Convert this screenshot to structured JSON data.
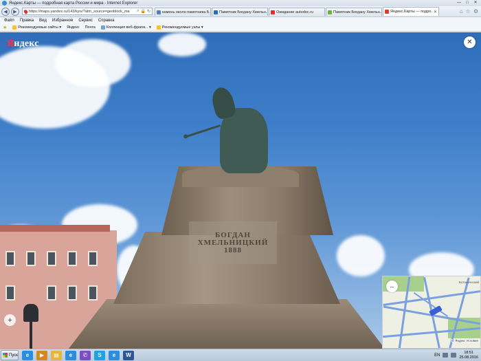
{
  "window": {
    "title": "Яндекс.Карты — подробная карта России и мира - Internet Explorer",
    "controls": [
      "—",
      "□",
      "✕"
    ]
  },
  "address_bar": {
    "url": "https://maps.yandex.ru/143/kyiv/?atm_source=geoblock_ma"
  },
  "tabs": [
    {
      "label": "камень около памятника Б...",
      "icon_color": "#5a7fbf",
      "active": false
    },
    {
      "label": "Памятник Богдану Хмельн...",
      "icon_color": "#2d6db4",
      "active": false
    },
    {
      "label": "Ожидание autodoc.ru",
      "icon_color": "#d9322f",
      "active": false
    },
    {
      "label": "Памятник Богдану Хмельн...",
      "icon_color": "#6cb33e",
      "active": false
    },
    {
      "label": "Яндекс.Карты — подро...",
      "icon_color": "#e23b2e",
      "active": true
    }
  ],
  "menu": [
    "Файл",
    "Правка",
    "Вид",
    "Избранное",
    "Сервис",
    "Справка"
  ],
  "favorites": [
    {
      "label": "Рекомендуемые сайты ▾",
      "icon_color": "#f2c230"
    },
    {
      "label": "Яндекс",
      "icon_color": ""
    },
    {
      "label": "Почта",
      "icon_color": ""
    },
    {
      "label": "Коллекция веб-фрагм... ▾",
      "icon_color": "#7aa1d1"
    },
    {
      "label": "Рекомендуемые узлы ▾",
      "icon_color": "#f2c230"
    }
  ],
  "panorama": {
    "logo_red": "Я",
    "logo_rest": "ндекс",
    "close_icon": "✕",
    "plaque_lines": [
      "БОГДАН",
      "ХМЕЛЬНИЦКИЙ",
      "1888"
    ],
    "zoom_in": "+",
    "zoom_out": "−",
    "share_icon": "⇪",
    "info_icon": "ℹ"
  },
  "minimap": {
    "expand_icon": "↔",
    "copyright": "© Яндекс Условия",
    "label": "Ботанический"
  },
  "taskbar": {
    "start_label": "Пуск",
    "apps": [
      {
        "name": "ie",
        "glyph": "e",
        "color": "#2a8de0"
      },
      {
        "name": "media",
        "glyph": "▶",
        "color": "#d8861e"
      },
      {
        "name": "explorer",
        "glyph": "▤",
        "color": "#e4b640"
      },
      {
        "name": "ie2",
        "glyph": "e",
        "color": "#2a8de0"
      },
      {
        "name": "viber",
        "glyph": "✆",
        "color": "#7a4fc0"
      },
      {
        "name": "skype",
        "glyph": "S",
        "color": "#1da3e3"
      },
      {
        "name": "ie3",
        "glyph": "e",
        "color": "#2a8de0"
      },
      {
        "name": "word",
        "glyph": "W",
        "color": "#2b5797"
      }
    ],
    "lang": "EN",
    "time": "18:51",
    "date": "25.08.2016"
  }
}
